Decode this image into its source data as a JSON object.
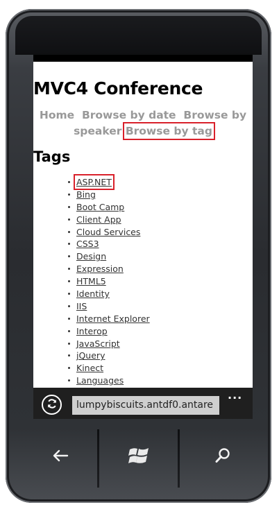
{
  "page": {
    "site_title": "MVC4 Conference",
    "nav": {
      "home": "Home",
      "browse_by_date": "Browse by date",
      "browse_by_speaker": "Browse by speaker",
      "browse_by_tag": "Browse by tag"
    },
    "section_heading": "Tags",
    "tags": [
      "ASP.NET",
      "Bing",
      "Boot Camp",
      "Client App",
      "Cloud Services",
      "CSS3",
      "Design",
      "Expression",
      "HTML5",
      "Identity",
      "IIS",
      "Internet Explorer",
      "Interop",
      "JavaScript",
      "jQuery",
      "Kinect",
      "Languages"
    ]
  },
  "browser": {
    "url": "lumpybiscuits.antdf0.antare",
    "refresh_icon": "refresh-icon",
    "more_icon": "ellipsis-icon",
    "more_text": "..."
  },
  "hardware": {
    "back_icon": "back-arrow-icon",
    "start_icon": "windows-logo-icon",
    "search_icon": "search-icon"
  },
  "colors": {
    "highlight": "#d9202a",
    "nav_text": "#999999",
    "address_bar": "#1f1f1f"
  }
}
